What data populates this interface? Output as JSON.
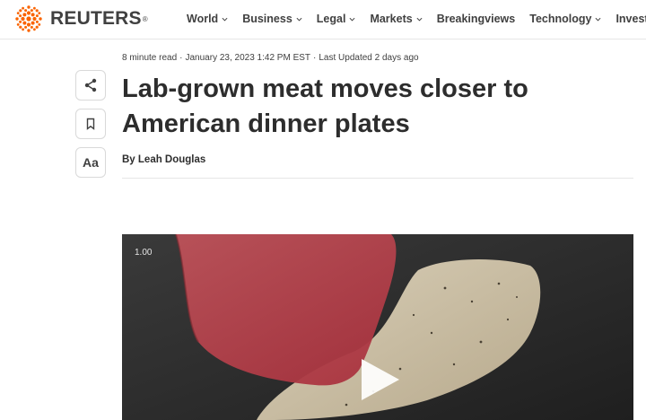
{
  "header": {
    "brand": "REUTERS",
    "brand_mark": "®",
    "nav": [
      {
        "label": "World",
        "has_menu": true
      },
      {
        "label": "Business",
        "has_menu": true
      },
      {
        "label": "Legal",
        "has_menu": true
      },
      {
        "label": "Markets",
        "has_menu": true
      },
      {
        "label": "Breakingviews",
        "has_menu": false
      },
      {
        "label": "Technology",
        "has_menu": true
      },
      {
        "label": "Investigati",
        "has_menu": false
      }
    ]
  },
  "article": {
    "read_time": "8 minute read",
    "date": "January 23, 2023 1:42 PM EST",
    "updated": "Last Updated 2 days ago",
    "separator": "·",
    "title": "Lab-grown meat moves closer to American dinner plates",
    "byline": "By Leah Douglas"
  },
  "tools": {
    "share_icon": "share-icon",
    "bookmark_icon": "bookmark-icon",
    "text_size_label": "Aa"
  },
  "video": {
    "playback_speed": "1.00",
    "play_icon": "play-icon"
  },
  "colors": {
    "brand_orange": "#fa6400",
    "text_dark": "#2d2d2d",
    "rule": "#e6e6e6"
  }
}
